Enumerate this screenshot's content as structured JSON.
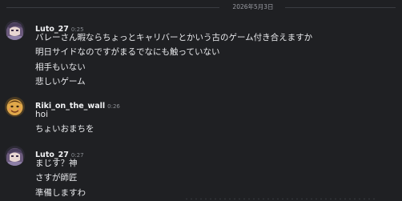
{
  "date_divider": "2026年5月3日",
  "messages": [
    {
      "username": "Luto_27",
      "time": "0:25",
      "avatar_icon": "anime-character-avatar",
      "lines": [
        "バレーさん暇ならちょっとキャリバーとかいう古のゲーム付き合えますか",
        "明日サイドなのですがまるでなにも触っていない",
        "相手もいない",
        "悲しいゲーム"
      ]
    },
    {
      "username": "Riki_on_the_wall",
      "time": "0:26",
      "avatar_icon": "face-avatar",
      "lines": [
        "hoi",
        "ちょいおまちを"
      ]
    },
    {
      "username": "Luto_27",
      "time": "0:27",
      "avatar_icon": "anime-character-avatar",
      "lines": [
        "まじす？神",
        "さすが師匠",
        "準備しますわ"
      ]
    }
  ],
  "colors": {
    "background": "#1f2023",
    "username": "#f2f3f5",
    "timestamp": "#8a8d93",
    "text": "#e8e9ec",
    "divider": "#3a3c42"
  }
}
